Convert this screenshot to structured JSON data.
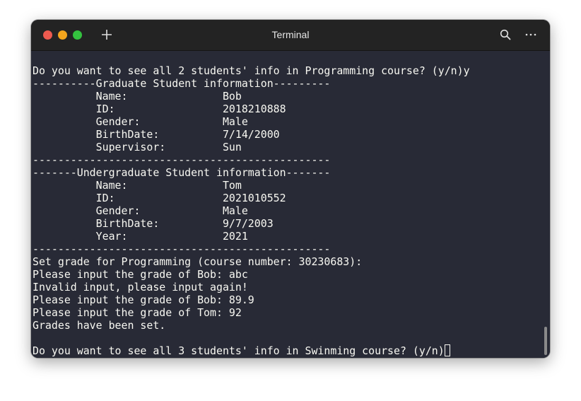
{
  "window": {
    "title": "Terminal"
  },
  "colors": {
    "close": "#ed5a4f",
    "minimize": "#f3a51d",
    "maximize": "#34c23f",
    "terminal_bg": "#282a36",
    "text": "#f8f8f2"
  },
  "icons": {
    "new_tab": "plus-icon",
    "search": "search-icon",
    "menu": "more-options-icon"
  },
  "terminal": {
    "lines": [
      "Do you want to see all 2 students' info in Programming course? (y/n)y",
      "----------Graduate Student information---------",
      "          Name:               Bob",
      "          ID:                 2018210888",
      "          Gender:             Male",
      "          BirthDate:          7/14/2000",
      "          Supervisor:         Sun",
      "-----------------------------------------------",
      "-------Undergraduate Student information-------",
      "          Name:               Tom",
      "          ID:                 2021010552",
      "          Gender:             Male",
      "          BirthDate:          9/7/2003",
      "          Year:               2021",
      "-----------------------------------------------",
      "Set grade for Programming (course number: 30230683):",
      "Please input the grade of Bob: abc",
      "Invalid input, please input again!",
      "Please input the grade of Bob: 89.9",
      "Please input the grade of Tom: 92",
      "Grades have been set.",
      "",
      "Do you want to see all 3 students' info in Swinming course? (y/n)"
    ]
  }
}
